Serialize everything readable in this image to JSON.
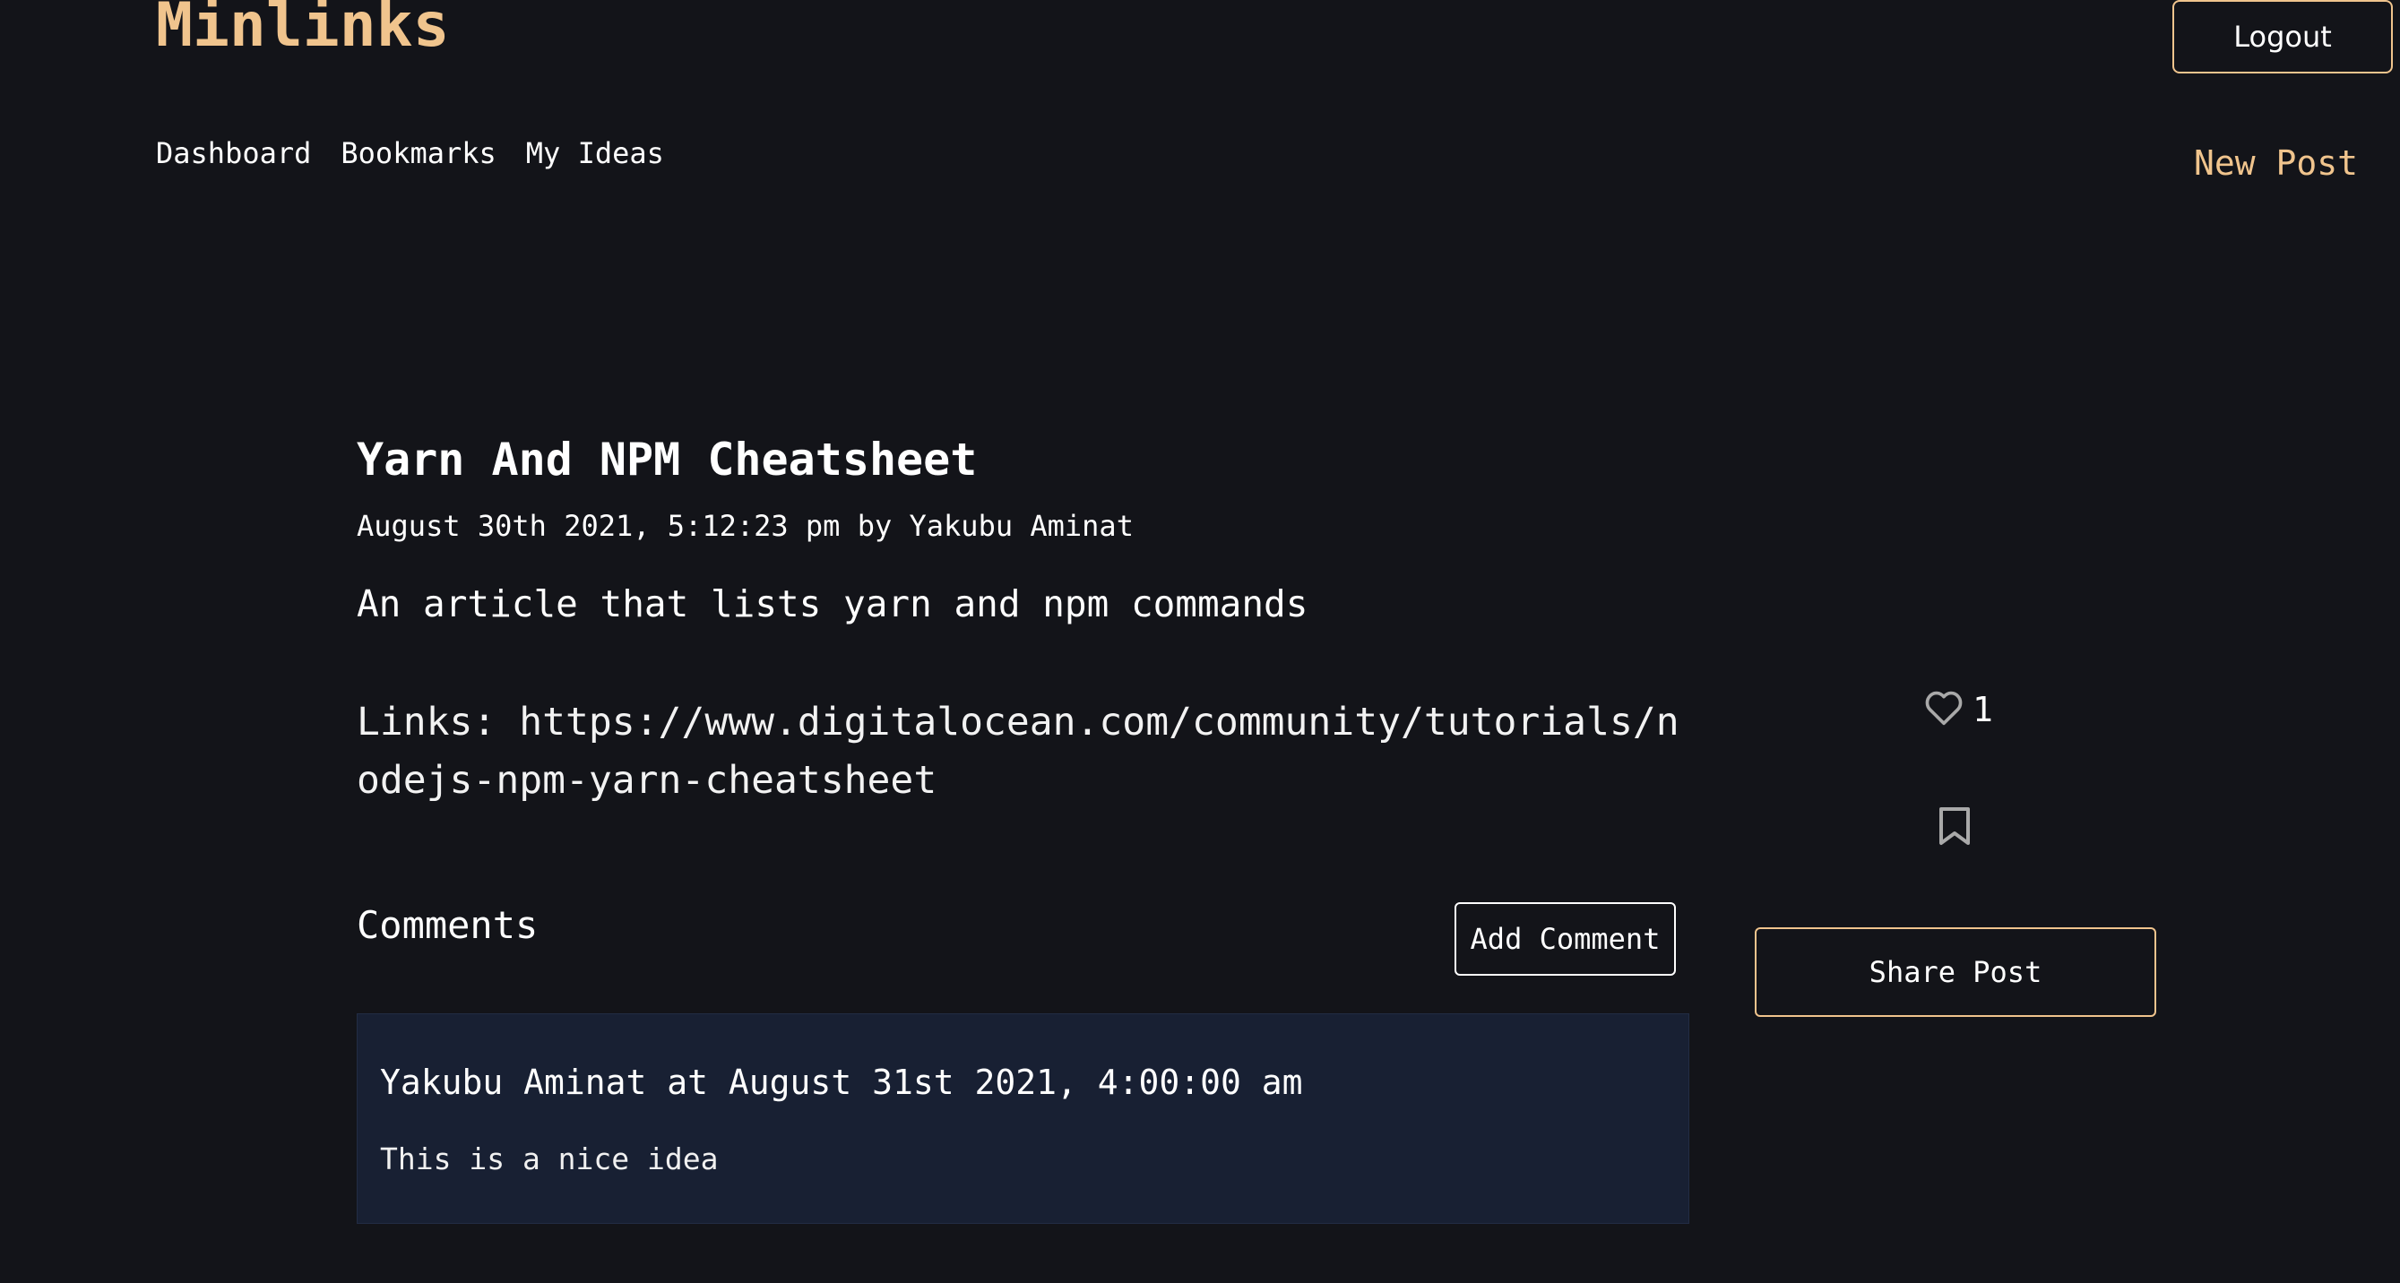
{
  "header": {
    "brand": "Minlinks",
    "logout_label": "Logout",
    "nav": [
      "Dashboard",
      "Bookmarks",
      "My Ideas"
    ],
    "new_post_label": "New Post"
  },
  "post": {
    "title": "Yarn And NPM Cheatsheet",
    "meta": "August 30th 2021, 5:12:23 pm by Yakubu Aminat",
    "description": "An article that lists yarn and npm commands",
    "links": "Links: https://www.digitalocean.com/community/tutorials/nodejs-npm-yarn-cheatsheet",
    "like_count": "1",
    "share_label": "Share Post"
  },
  "comments": {
    "heading": "Comments",
    "add_label": "Add Comment",
    "items": [
      {
        "author_line": "Yakubu Aminat at August 31st 2021, 4:00:00 am",
        "text": "This is a nice idea"
      }
    ]
  },
  "icons": {
    "like": "heart-icon",
    "bookmark": "bookmark-icon"
  },
  "colors": {
    "background": "#131419",
    "accent": "#f0c48d",
    "comment_card": "#182033",
    "icon_gray": "#a9a9a9"
  }
}
